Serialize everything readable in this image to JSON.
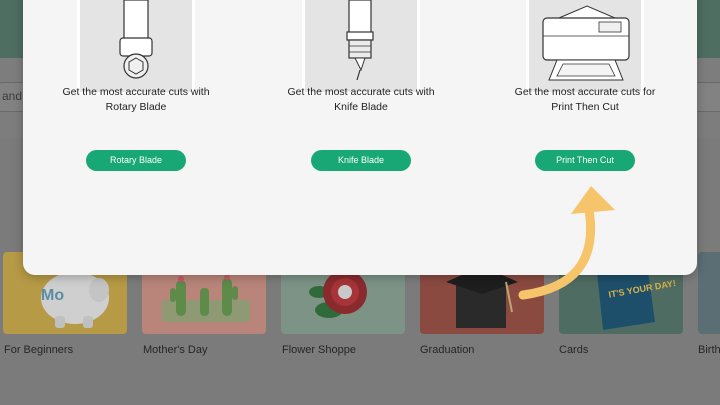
{
  "background": {
    "search_text": "and F",
    "categories": [
      {
        "label": "For Beginners"
      },
      {
        "label": "Mother's Day"
      },
      {
        "label": "Flower Shoppe"
      },
      {
        "label": "Graduation"
      },
      {
        "label": "Cards"
      },
      {
        "label": "Birth"
      }
    ],
    "card_texts": {
      "beginners_text": "Mo",
      "cards_text": "IT'S YOUR DAY!"
    }
  },
  "modal": {
    "options": [
      {
        "line1": "Get the most accurate cuts with",
        "line2": "Rotary Blade",
        "button": "Rotary Blade",
        "icon": "rotary-blade-icon"
      },
      {
        "line1": "Get the most accurate cuts with",
        "line2": "Knife Blade",
        "button": "Knife Blade",
        "icon": "knife-blade-icon"
      },
      {
        "line1": "Get the most accurate cuts for",
        "line2": "Print Then Cut",
        "button": "Print Then Cut",
        "icon": "printer-icon"
      }
    ]
  },
  "colors": {
    "button": "#18a875",
    "header": "#4f6e62",
    "arrow": "#f6c46a"
  }
}
